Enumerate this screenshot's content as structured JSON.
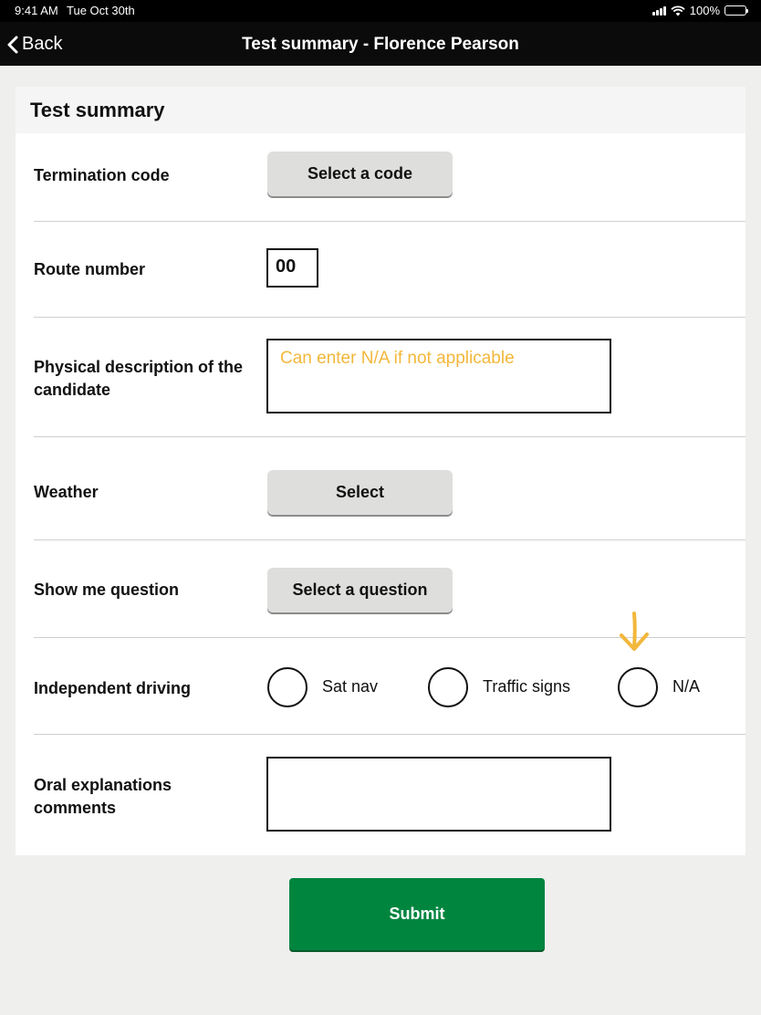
{
  "status": {
    "time": "9:41 AM",
    "date": "Tue Oct 30th",
    "battery": "100%"
  },
  "nav": {
    "back_label": "Back",
    "title": "Test summary - Florence Pearson"
  },
  "card": {
    "heading": "Test summary"
  },
  "fields": {
    "termination": {
      "label": "Termination code",
      "button": "Select a code"
    },
    "route": {
      "label": "Route number",
      "value": "00"
    },
    "physical": {
      "label": "Physical description of the candidate",
      "placeholder": "Can enter N/A if not applicable"
    },
    "weather": {
      "label": "Weather",
      "button": "Select"
    },
    "show_me": {
      "label": "Show me question",
      "button": "Select a question"
    },
    "independent": {
      "label": "Independent driving",
      "options": [
        "Sat nav",
        "Traffic signs",
        "N/A"
      ]
    },
    "oral": {
      "label": "Oral explanations comments",
      "value": ""
    }
  },
  "submit_label": "Submit",
  "colors": {
    "submit": "#00853f",
    "placeholder": "#f3b73b",
    "annotation_arrow": "#f3b73b"
  }
}
